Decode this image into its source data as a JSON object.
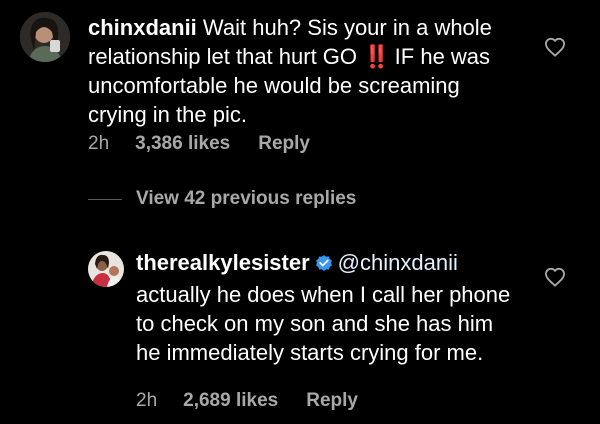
{
  "comments": [
    {
      "username": "chinxdanii",
      "text_before": "Wait huh? Sis your in a whole relationship let that hurt GO",
      "emoji": "‼️",
      "text_after": " IF he was uncomfortable he would be screaming crying in the pic.",
      "time": "2h",
      "likes": "3,386 likes",
      "reply_label": "Reply"
    },
    {
      "username": "therealkylesister",
      "mention": "@chinxdanii",
      "text": " actually he does when I call her phone to check on my son and she has him he immediately starts crying for me.",
      "time": "2h",
      "likes": "2,689 likes",
      "reply_label": "Reply"
    }
  ],
  "view_replies": {
    "label": "View 42 previous replies"
  },
  "colors": {
    "background": "#000000",
    "text": "#ffffff",
    "meta": "#a8a8a8",
    "verified": "#3897f0",
    "emoji_red": "#ed1c24"
  },
  "icons": [
    "heart-outline-icon",
    "verified-badge-icon",
    "double-exclamation-emoji"
  ]
}
